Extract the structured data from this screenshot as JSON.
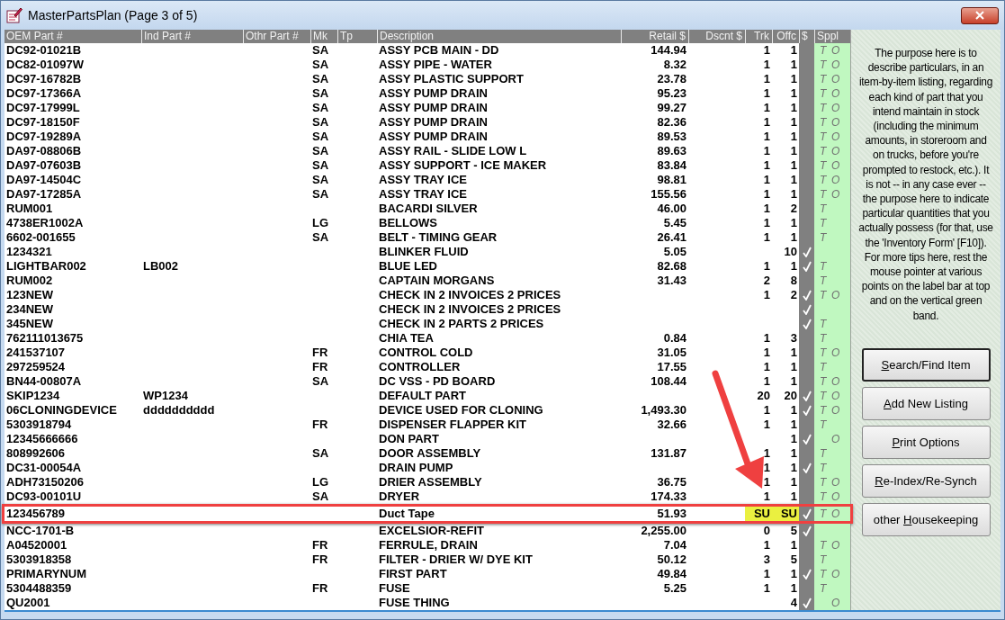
{
  "window": {
    "title": "MasterPartsPlan (Page 3 of 5)"
  },
  "columns": [
    "OEM Part #",
    "Ind Part #",
    "Othr Part #",
    "Mk",
    "Tp",
    "Description",
    "Retail $",
    "Dscnt $",
    "Trk",
    "Offc",
    "$",
    "Sppl"
  ],
  "rows": [
    {
      "oem": "DC92-01021B",
      "mk": "SA",
      "desc": "ASSY PCB MAIN - DD",
      "retail": "144.94",
      "trk": "1",
      "offc": "1",
      "checked": false,
      "t": "T",
      "o": "O",
      "flagged": false,
      "annotated": false
    },
    {
      "oem": "DC82-01097W",
      "mk": "SA",
      "desc": "ASSY PIPE - WATER",
      "retail": "8.32",
      "trk": "1",
      "offc": "1",
      "checked": false,
      "t": "T",
      "o": "O",
      "flagged": false,
      "annotated": false
    },
    {
      "oem": "DC97-16782B",
      "mk": "SA",
      "desc": "ASSY PLASTIC SUPPORT",
      "retail": "23.78",
      "trk": "1",
      "offc": "1",
      "checked": false,
      "t": "T",
      "o": "O",
      "flagged": false,
      "annotated": false
    },
    {
      "oem": "DC97-17366A",
      "mk": "SA",
      "desc": "ASSY PUMP DRAIN",
      "retail": "95.23",
      "trk": "1",
      "offc": "1",
      "checked": false,
      "t": "T",
      "o": "O",
      "flagged": false,
      "annotated": false
    },
    {
      "oem": "DC97-17999L",
      "mk": "SA",
      "desc": "ASSY PUMP DRAIN",
      "retail": "99.27",
      "trk": "1",
      "offc": "1",
      "checked": false,
      "t": "T",
      "o": "O",
      "flagged": false,
      "annotated": false
    },
    {
      "oem": "DC97-18150F",
      "mk": "SA",
      "desc": "ASSY PUMP DRAIN",
      "retail": "82.36",
      "trk": "1",
      "offc": "1",
      "checked": false,
      "t": "T",
      "o": "O",
      "flagged": false,
      "annotated": false
    },
    {
      "oem": "DC97-19289A",
      "mk": "SA",
      "desc": "ASSY PUMP DRAIN",
      "retail": "89.53",
      "trk": "1",
      "offc": "1",
      "checked": false,
      "t": "T",
      "o": "O",
      "flagged": false,
      "annotated": false
    },
    {
      "oem": "DA97-08806B",
      "mk": "SA",
      "desc": "ASSY RAIL - SLIDE LOW L",
      "retail": "89.63",
      "trk": "1",
      "offc": "1",
      "checked": false,
      "t": "T",
      "o": "O",
      "flagged": false,
      "annotated": false
    },
    {
      "oem": "DA97-07603B",
      "mk": "SA",
      "desc": "ASSY SUPPORT - ICE MAKER",
      "retail": "83.84",
      "trk": "1",
      "offc": "1",
      "checked": false,
      "t": "T",
      "o": "O",
      "flagged": false,
      "annotated": false
    },
    {
      "oem": "DA97-14504C",
      "mk": "SA",
      "desc": "ASSY TRAY ICE",
      "retail": "98.81",
      "trk": "1",
      "offc": "1",
      "checked": false,
      "t": "T",
      "o": "O",
      "flagged": false,
      "annotated": false
    },
    {
      "oem": "DA97-17285A",
      "mk": "SA",
      "desc": "ASSY TRAY ICE",
      "retail": "155.56",
      "trk": "1",
      "offc": "1",
      "checked": false,
      "t": "T",
      "o": "O",
      "flagged": false,
      "annotated": false
    },
    {
      "oem": "RUM001",
      "desc": "BACARDI SILVER",
      "retail": "46.00",
      "trk": "1",
      "offc": "2",
      "checked": false,
      "t": "T",
      "flagged": false,
      "annotated": false
    },
    {
      "oem": "4738ER1002A",
      "mk": "LG",
      "desc": "BELLOWS",
      "retail": "5.45",
      "trk": "1",
      "offc": "1",
      "checked": false,
      "t": "T",
      "flagged": false,
      "annotated": false
    },
    {
      "oem": "6602-001655",
      "mk": "SA",
      "desc": "BELT - TIMING GEAR",
      "retail": "26.41",
      "trk": "1",
      "offc": "1",
      "checked": false,
      "t": "T",
      "flagged": false,
      "annotated": false
    },
    {
      "oem": "1234321",
      "desc": "BLINKER FLUID",
      "retail": "5.05",
      "offc": "10",
      "checked": true,
      "flagged": false,
      "annotated": false
    },
    {
      "oem": "LIGHTBAR002",
      "ind": "LB002",
      "desc": "BLUE LED",
      "retail": "82.68",
      "trk": "1",
      "offc": "1",
      "checked": true,
      "t": "T",
      "flagged": false,
      "annotated": false
    },
    {
      "oem": "RUM002",
      "desc": "CAPTAIN MORGANS",
      "retail": "31.43",
      "trk": "2",
      "offc": "8",
      "checked": false,
      "t": "T",
      "flagged": false,
      "annotated": false
    },
    {
      "oem": "123NEW",
      "desc": "CHECK IN 2 INVOICES 2 PRICES",
      "trk": "1",
      "offc": "2",
      "checked": true,
      "t": "T",
      "o": "O",
      "flagged": false,
      "annotated": false
    },
    {
      "oem": "234NEW",
      "desc": "CHECK IN 2 INVOICES 2 PRICES",
      "checked": true,
      "flagged": false,
      "annotated": false
    },
    {
      "oem": "345NEW",
      "desc": "CHECK IN 2 PARTS 2 PRICES",
      "checked": true,
      "t": "T",
      "flagged": false,
      "annotated": false
    },
    {
      "oem": "762111013675",
      "desc": "CHIA TEA",
      "retail": "0.84",
      "trk": "1",
      "offc": "3",
      "checked": false,
      "t": "T",
      "flagged": false,
      "annotated": false
    },
    {
      "oem": "241537107",
      "mk": "FR",
      "desc": "CONTROL COLD",
      "retail": "31.05",
      "trk": "1",
      "offc": "1",
      "checked": false,
      "t": "T",
      "o": "O",
      "flagged": false,
      "annotated": false
    },
    {
      "oem": "297259524",
      "mk": "FR",
      "desc": "CONTROLLER",
      "retail": "17.55",
      "trk": "1",
      "offc": "1",
      "checked": false,
      "t": "T",
      "flagged": false,
      "annotated": false
    },
    {
      "oem": "BN44-00807A",
      "mk": "SA",
      "desc": "DC VSS - PD BOARD",
      "retail": "108.44",
      "trk": "1",
      "offc": "1",
      "checked": false,
      "t": "T",
      "o": "O",
      "flagged": false,
      "annotated": false
    },
    {
      "oem": "SKIP1234",
      "ind": "WP1234",
      "desc": "DEFAULT PART",
      "trk": "20",
      "offc": "20",
      "checked": true,
      "t": "T",
      "o": "O",
      "flagged": false,
      "annotated": false
    },
    {
      "oem": "06CLONINGDEVICE",
      "ind": "dddddddddd",
      "desc": "DEVICE USED FOR CLONING",
      "retail": "1,493.30",
      "trk": "1",
      "offc": "1",
      "checked": true,
      "t": "T",
      "o": "O",
      "flagged": false,
      "annotated": false
    },
    {
      "oem": "5303918794",
      "mk": "FR",
      "desc": "DISPENSER FLAPPER KIT",
      "retail": "32.66",
      "trk": "1",
      "offc": "1",
      "checked": false,
      "t": "T",
      "flagged": false,
      "annotated": false
    },
    {
      "oem": "12345666666",
      "desc": "DON PART",
      "offc": "1",
      "checked": true,
      "o": "O",
      "flagged": false,
      "annotated": false
    },
    {
      "oem": "808992606",
      "mk": "SA",
      "desc": "DOOR ASSEMBLY",
      "retail": "131.87",
      "trk": "1",
      "offc": "1",
      "checked": false,
      "t": "T",
      "flagged": false,
      "annotated": false
    },
    {
      "oem": "DC31-00054A",
      "desc": "DRAIN PUMP",
      "trk": "1",
      "offc": "1",
      "checked": true,
      "t": "T",
      "flagged": false,
      "annotated": false
    },
    {
      "oem": "ADH73150206",
      "mk": "LG",
      "desc": "DRIER ASSEMBLY",
      "retail": "36.75",
      "trk": "1",
      "offc": "1",
      "checked": false,
      "t": "T",
      "o": "O",
      "flagged": false,
      "annotated": false
    },
    {
      "oem": "DC93-00101U",
      "mk": "SA",
      "desc": "DRYER",
      "retail": "174.33",
      "trk": "1",
      "offc": "1",
      "checked": false,
      "t": "T",
      "o": "O",
      "flagged": false,
      "annotated": false
    },
    {
      "oem": "123456789",
      "desc": "Duct Tape",
      "retail": "51.93",
      "trk": "SU",
      "offc": "SU",
      "checked": true,
      "t": "T",
      "o": "O",
      "flagged": true,
      "annotated": true
    },
    {
      "oem": "NCC-1701-B",
      "desc": "EXCELSIOR-REFIT",
      "retail": "2,255.00",
      "trk": "0",
      "offc": "5",
      "checked": true,
      "flagged": false,
      "annotated": false
    },
    {
      "oem": "A04520001",
      "mk": "FR",
      "desc": "FERRULE, DRAIN",
      "retail": "7.04",
      "trk": "1",
      "offc": "1",
      "checked": false,
      "t": "T",
      "o": "O",
      "flagged": false,
      "annotated": false
    },
    {
      "oem": "5303918358",
      "mk": "FR",
      "desc": "FILTER - DRIER W/ DYE KIT",
      "retail": "50.12",
      "trk": "3",
      "offc": "5",
      "checked": false,
      "t": "T",
      "flagged": false,
      "annotated": false
    },
    {
      "oem": "PRIMARYNUM",
      "desc": "FIRST PART",
      "retail": "49.84",
      "trk": "1",
      "offc": "1",
      "checked": true,
      "t": "T",
      "o": "O",
      "flagged": false,
      "annotated": false
    },
    {
      "oem": "5304488359",
      "mk": "FR",
      "desc": "FUSE",
      "retail": "5.25",
      "trk": "1",
      "offc": "1",
      "checked": false,
      "t": "T",
      "flagged": false,
      "annotated": false
    },
    {
      "oem": "QU2001",
      "desc": "FUSE THING",
      "offc": "4",
      "checked": true,
      "o": "O",
      "flagged": false,
      "annotated": false
    }
  ],
  "help_text": "The purpose here is to describe particulars, in an item-by-item listing, regarding each kind of part that you intend maintain in stock (including the minimum amounts, in storeroom and on trucks, before you're prompted to restock, etc.).  It is not -- in any case ever -- the purpose here to indicate particular quantities that you actually possess (for that, use the 'Inventory Form' [F10]).  For more tips here, rest the mouse pointer at various points on the label bar at top and on the vertical green band.",
  "buttons": [
    {
      "key": "S",
      "after": "earch/Find Item",
      "focused": true
    },
    {
      "key": "A",
      "after": "dd New Listing",
      "focused": false
    },
    {
      "key": "P",
      "after": "rint Options",
      "focused": false
    },
    {
      "key": "R",
      "after": "e-Index/Re-Synch",
      "focused": false
    },
    {
      "before": "other ",
      "key": "H",
      "after": "ousekeeping",
      "focused": false
    }
  ]
}
